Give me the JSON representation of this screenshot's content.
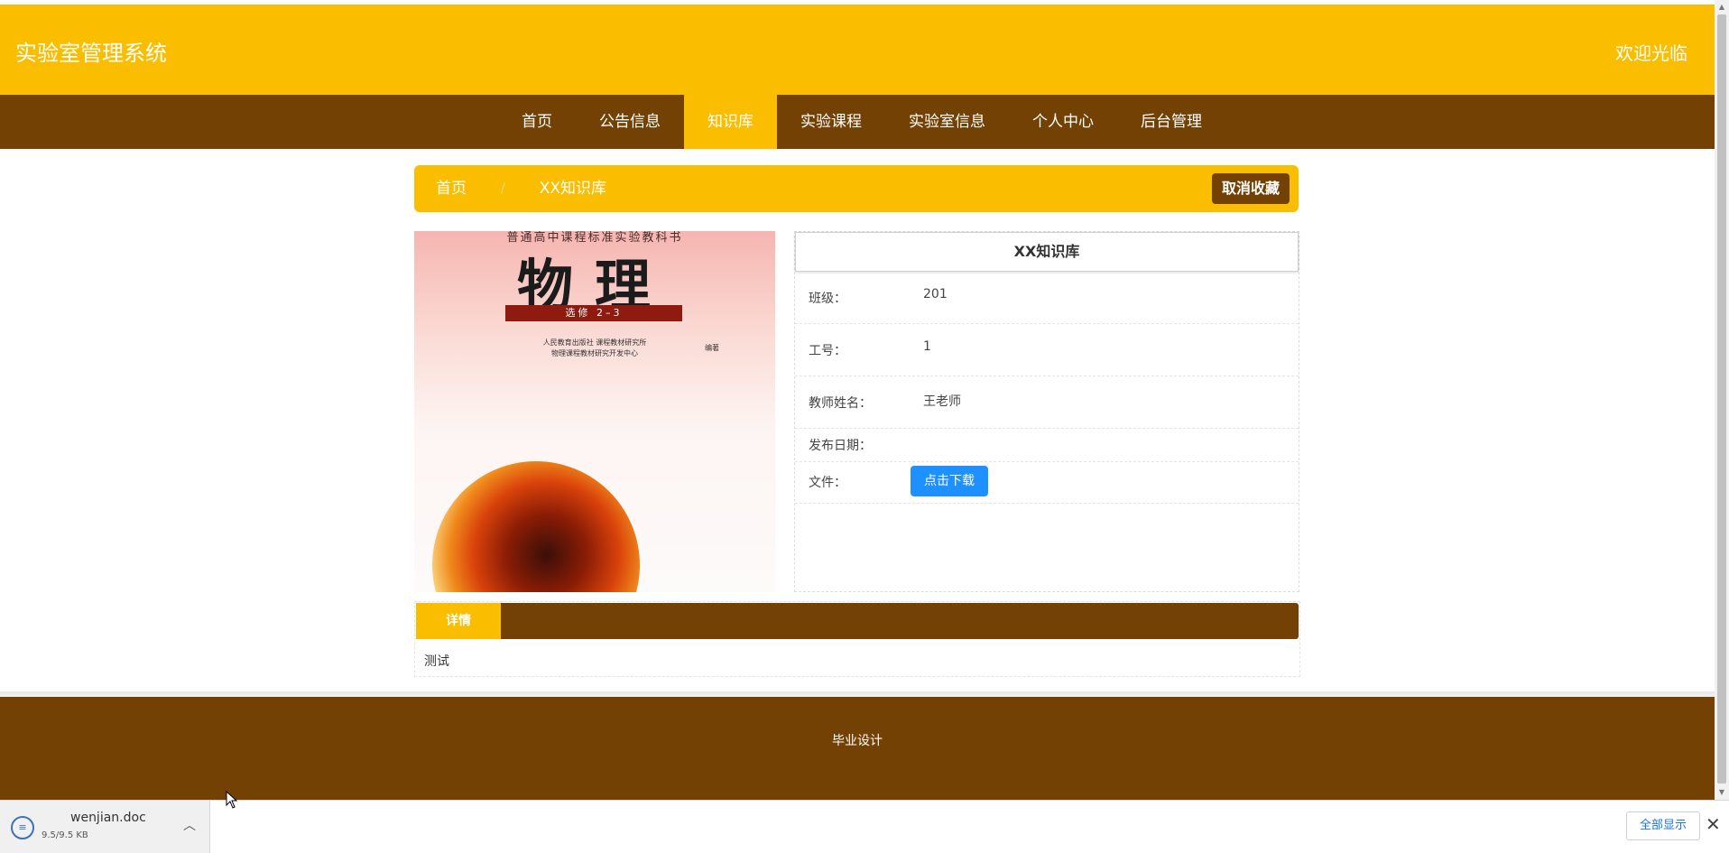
{
  "header": {
    "site_title": "实验室管理系统",
    "welcome": "欢迎光临"
  },
  "nav": {
    "items": [
      {
        "label": "首页"
      },
      {
        "label": "公告信息"
      },
      {
        "label": "知识库"
      },
      {
        "label": "实验课程"
      },
      {
        "label": "实验室信息"
      },
      {
        "label": "个人中心"
      },
      {
        "label": "后台管理"
      }
    ],
    "active": "知识库"
  },
  "breadcrumb": {
    "home": "首页",
    "separator": "/",
    "current": "XX知识库",
    "unfavorite_label": "取消收藏"
  },
  "cover": {
    "subtitle": "普通高中课程标准实验教科书",
    "title": "物理",
    "ribbon": "选修 2–3",
    "publisher_line1": "人民教育出版社  课程教材研究所",
    "publisher_line2": "物理课程教材研究开发中心",
    "publisher_suffix": "编著"
  },
  "info": {
    "title": "XX知识库",
    "class_label": "班级：",
    "class_value": "201",
    "id_label": "工号：",
    "id_value": "1",
    "teacher_label": "教师姓名：",
    "teacher_value": "王老师",
    "date_label": "发布日期：",
    "date_value": "",
    "file_label": "文件：",
    "download_label": "点击下载"
  },
  "detail": {
    "tab_label": "详情",
    "content": "测试"
  },
  "footer": {
    "text": "毕业设计"
  },
  "download_bar": {
    "file_name": "wenjian.doc",
    "file_size": "9.5/9.5 KB",
    "show_all_label": "全部显示"
  },
  "colors": {
    "accent_yellow": "#fbbd00",
    "brown": "#744105",
    "download_blue": "#1e90ff"
  }
}
